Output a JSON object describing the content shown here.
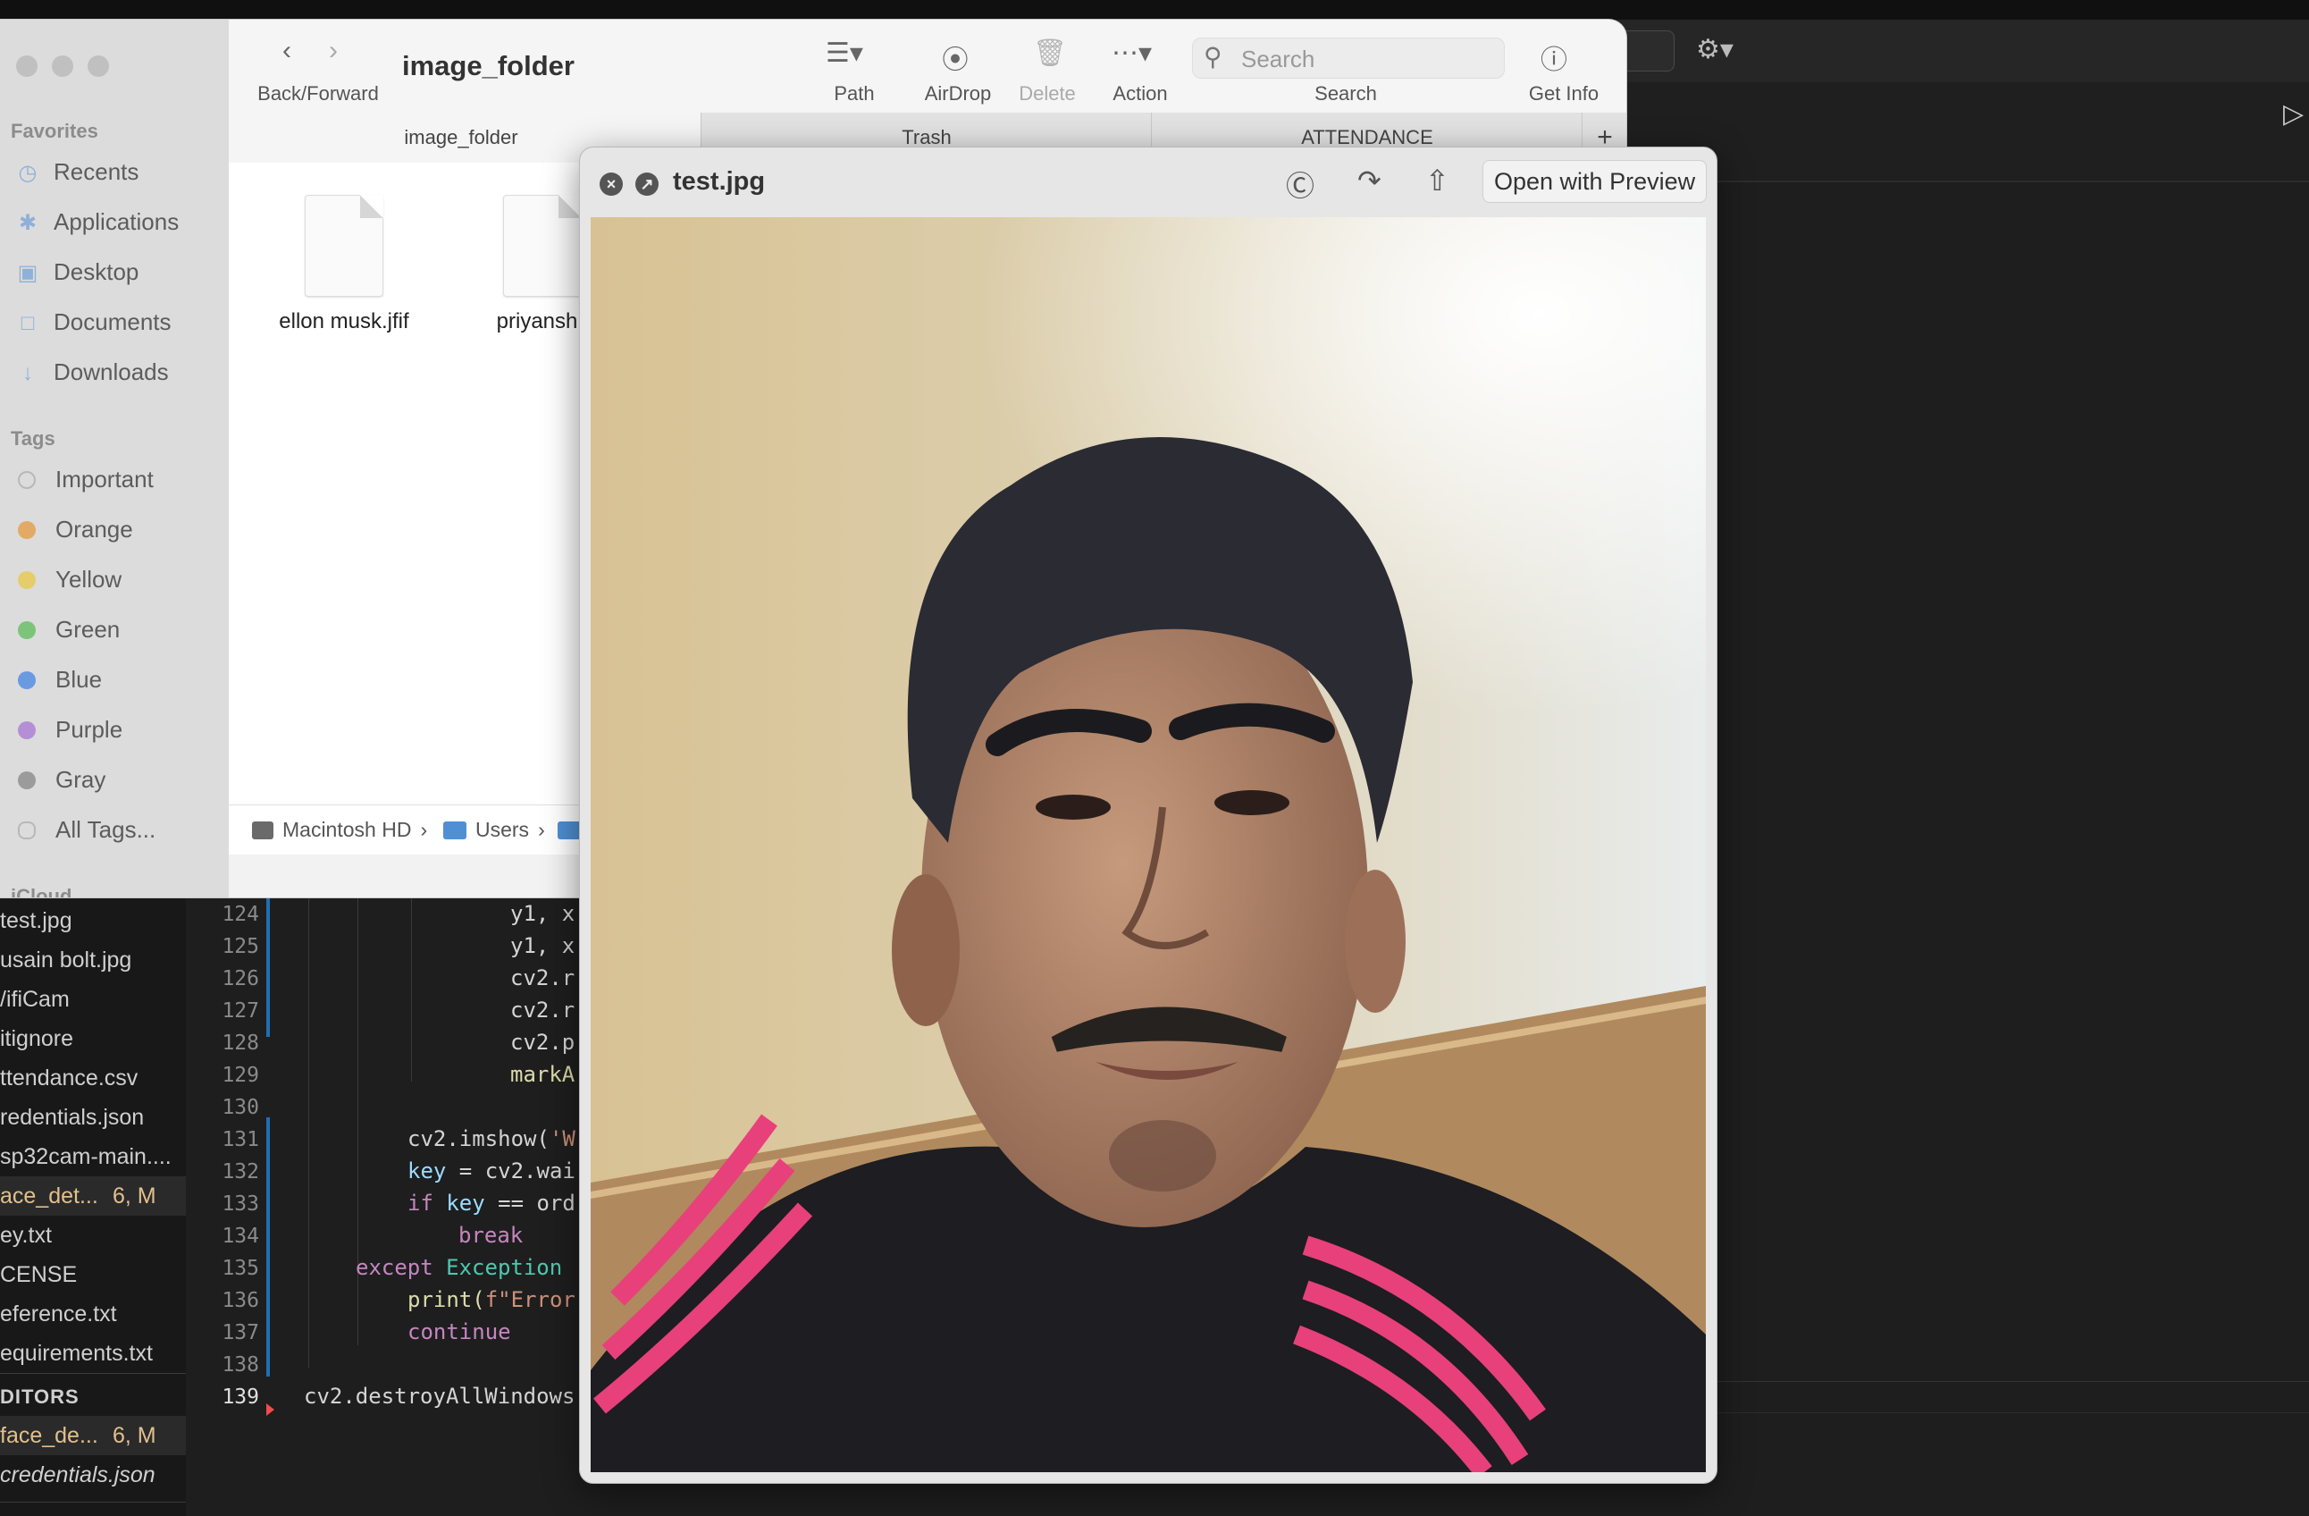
{
  "finder": {
    "title": "image_folder",
    "toolbar": {
      "back_forward": "Back/Forward",
      "path": "Path",
      "airdrop": "AirDrop",
      "delete": "Delete",
      "action": "Action",
      "search_label": "Search",
      "search_placeholder": "Search",
      "get_info": "Get Info"
    },
    "tabs": [
      "image_folder",
      "Trash",
      "ATTENDANCE"
    ],
    "sidebar": {
      "favorites_heading": "Favorites",
      "favorites": [
        "Recents",
        "Applications",
        "Desktop",
        "Documents",
        "Downloads"
      ],
      "tags_heading": "Tags",
      "tags": [
        {
          "label": "Important",
          "color": "#c8c8c8"
        },
        {
          "label": "Orange",
          "color": "#e3aa66"
        },
        {
          "label": "Yellow",
          "color": "#e5cd6a"
        },
        {
          "label": "Green",
          "color": "#7cc47a"
        },
        {
          "label": "Blue",
          "color": "#6a9be0"
        },
        {
          "label": "Purple",
          "color": "#b48fd6"
        },
        {
          "label": "Gray",
          "color": "#9b9b9b"
        },
        {
          "label": "All Tags..."
        }
      ],
      "icloud_heading": "iCloud"
    },
    "files": [
      "ellon musk.jfif",
      "priyansh.j"
    ],
    "path": [
      "Macintosh HD",
      "Users"
    ]
  },
  "quicklook": {
    "title": "test.jpg",
    "open_button": "Open with Preview"
  },
  "editor": {
    "explorer_items": [
      {
        "label": "test.jpg"
      },
      {
        "label": "usain bolt.jpg"
      },
      {
        "label": "/ifiCam"
      },
      {
        "label": "itignore"
      },
      {
        "label": "ttendance.csv"
      },
      {
        "label": "redentials.json"
      },
      {
        "label": "sp32cam-main...."
      },
      {
        "label": "ace_det...",
        "badge": "6, M"
      },
      {
        "label": "ey.txt"
      },
      {
        "label": "CENSE"
      },
      {
        "label": "eference.txt"
      },
      {
        "label": "equirements.txt"
      }
    ],
    "open_editors_heading": "DITORS",
    "open_editors": [
      {
        "label": "face_de...",
        "badge": "6, M"
      },
      {
        "label": "credentials.json"
      }
    ],
    "line_numbers": [
      "124",
      "125",
      "126",
      "127",
      "128",
      "129",
      "130",
      "131",
      "132",
      "133",
      "134",
      "135",
      "136",
      "137",
      "138",
      "139"
    ],
    "code": {
      "l124": "y1, x",
      "l125": "y1, x",
      "l126": "cv2.r",
      "l127": "cv2.r",
      "l128": "cv2.p",
      "l129": "markA",
      "l131_a": "cv2.imshow(",
      "l131_b": "'W",
      "l132_a": "key",
      "l132_b": " = cv2.wai",
      "l133_a": "if ",
      "l133_b": "key",
      "l133_c": " == ord",
      "l134": "break",
      "l135_a": "except ",
      "l135_b": "Exception",
      "l136_a": "print(",
      "l136_b": "f\"Error",
      "l137": "continue",
      "l139": "cv2.destroyAllWindows"
    }
  },
  "colors": {
    "finder_sidebar": "#dcdcdc",
    "editor_bg": "#1e1e1e",
    "accent_blue": "#1f6fb3"
  }
}
